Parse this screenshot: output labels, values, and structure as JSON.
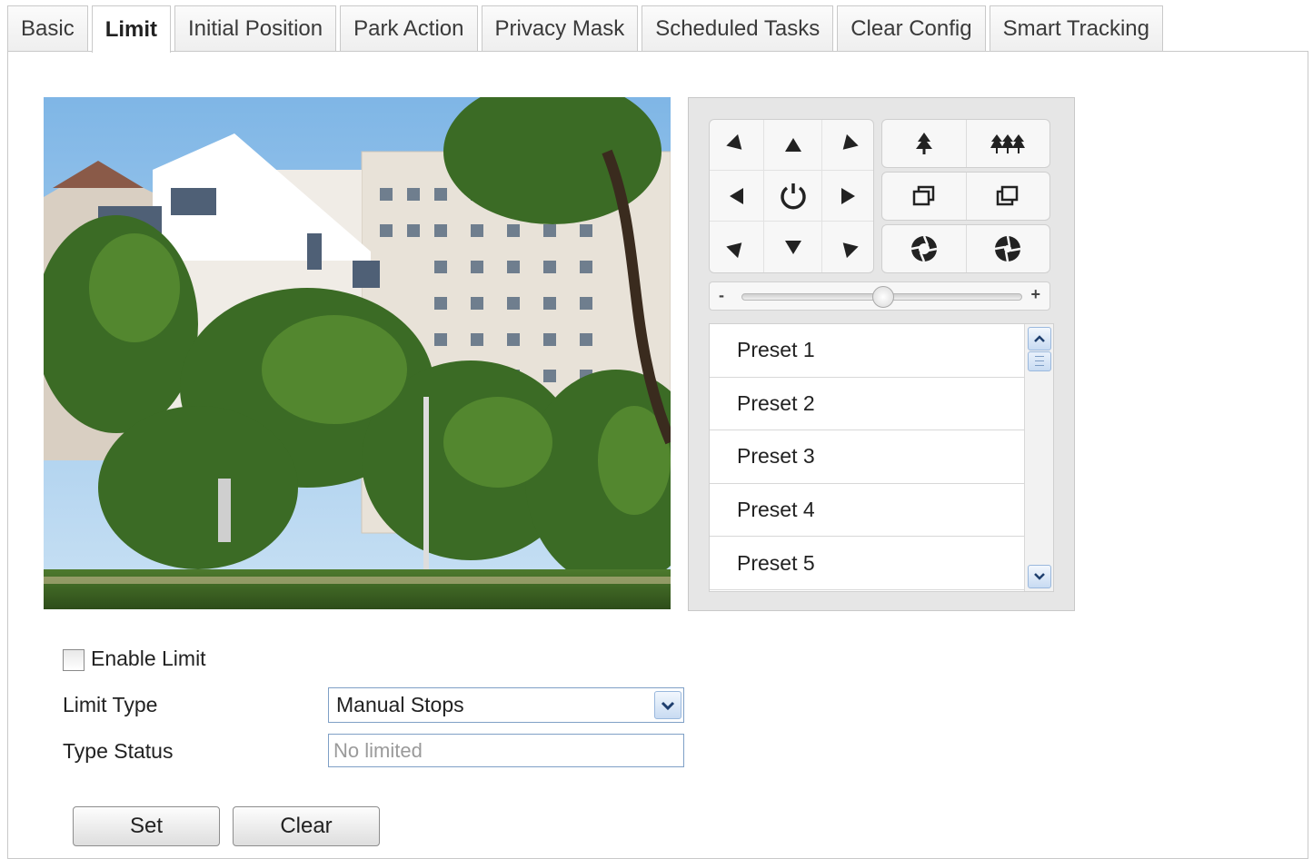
{
  "tabs": [
    {
      "label": "Basic"
    },
    {
      "label": "Limit",
      "active": true
    },
    {
      "label": "Initial Position"
    },
    {
      "label": "Park Action"
    },
    {
      "label": "Privacy Mask"
    },
    {
      "label": "Scheduled Tasks"
    },
    {
      "label": "Clear Config"
    },
    {
      "label": "Smart Tracking"
    }
  ],
  "ptz": {
    "direction_icons": [
      "pan-up-left-icon",
      "pan-up-icon",
      "pan-up-right-icon",
      "pan-left-icon",
      "auto-pan-icon",
      "pan-right-icon",
      "pan-down-left-icon",
      "pan-down-icon",
      "pan-down-right-icon"
    ],
    "tool_icons": [
      "zoom-in-icon",
      "zoom-out-icon",
      "focus-near-icon",
      "focus-far-icon",
      "iris-open-icon",
      "iris-close-icon"
    ],
    "speed_minus": "-",
    "speed_plus": "+",
    "speed_level": 0.5,
    "presets": [
      "Preset 1",
      "Preset 2",
      "Preset 3",
      "Preset 4",
      "Preset 5"
    ]
  },
  "form": {
    "enable_limit_label": "Enable Limit",
    "enable_limit_checked": false,
    "limit_type_label": "Limit Type",
    "limit_type_value": "Manual Stops",
    "type_status_label": "Type Status",
    "type_status_value": "No limited"
  },
  "buttons": {
    "set_label": "Set",
    "clear_label": "Clear"
  }
}
